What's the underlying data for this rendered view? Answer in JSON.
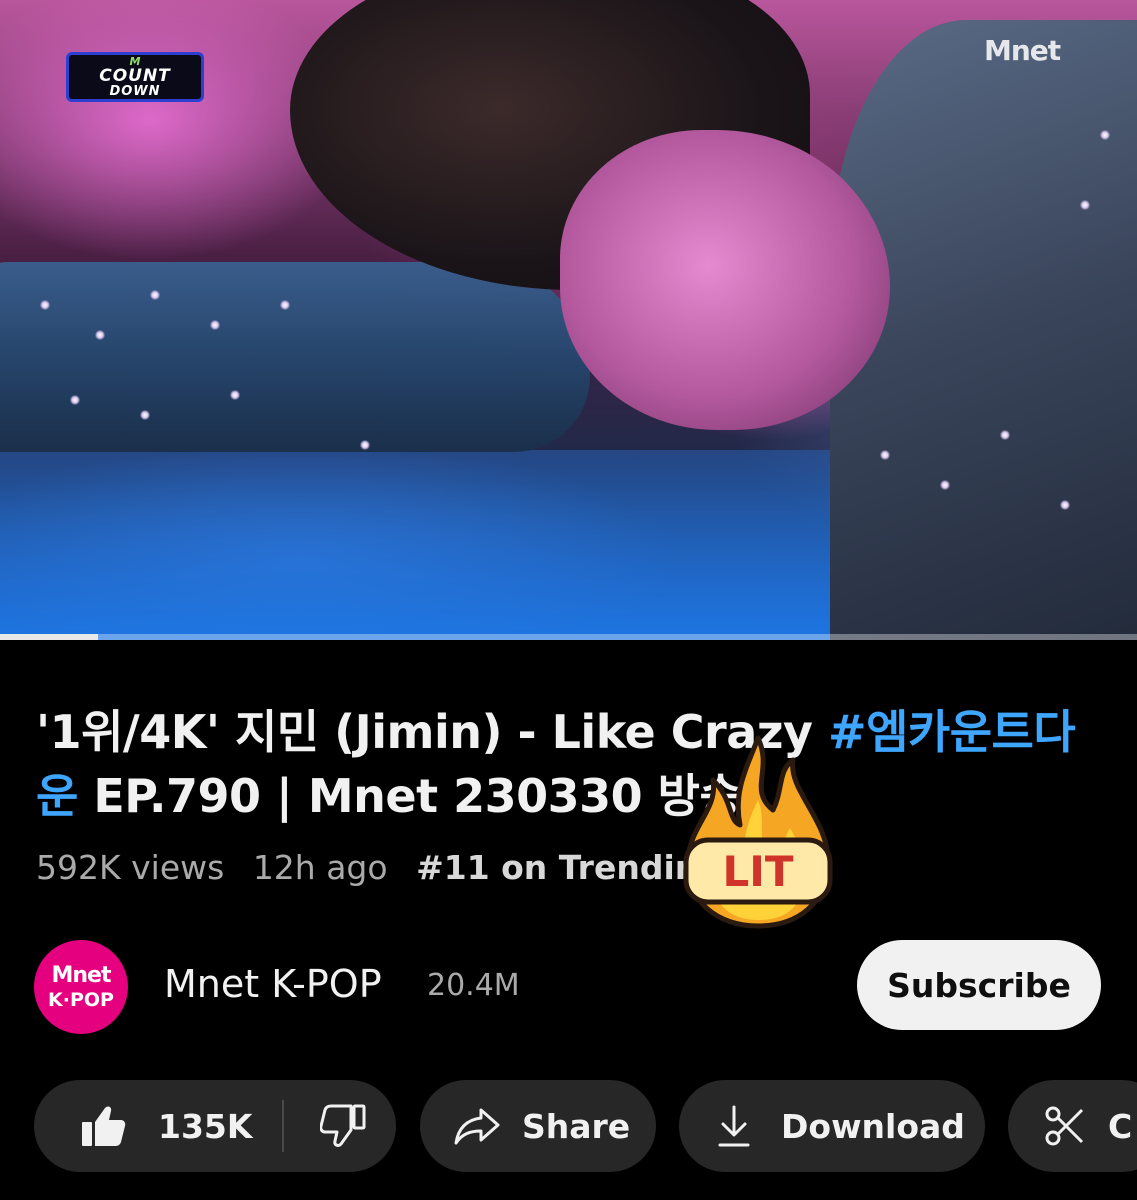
{
  "video": {
    "overlay_logo_left": {
      "line_top": "M",
      "line1": "COUNT",
      "line2": "DOWN"
    },
    "overlay_logo_right": "Mnet",
    "progress_fraction": 0.086
  },
  "title": {
    "text_before": "'1위/4K' 지민 (Jimin) - Like Crazy ",
    "hashtag": "#엠카운트다운",
    "text_after": " EP.790 | Mnet 230330 방송"
  },
  "meta": {
    "views": "592K views",
    "age": "12h ago",
    "trending": "#11 on Trending"
  },
  "sticker": {
    "label": "LIT"
  },
  "channel": {
    "avatar_line1": "Mnet",
    "avatar_line2": "K·POP",
    "name": "Mnet K-POP",
    "subscribers": "20.4M",
    "subscribe_label": "Subscribe"
  },
  "actions": {
    "likes": "135K",
    "share_label": "Share",
    "download_label": "Download",
    "clip_label": "C"
  }
}
